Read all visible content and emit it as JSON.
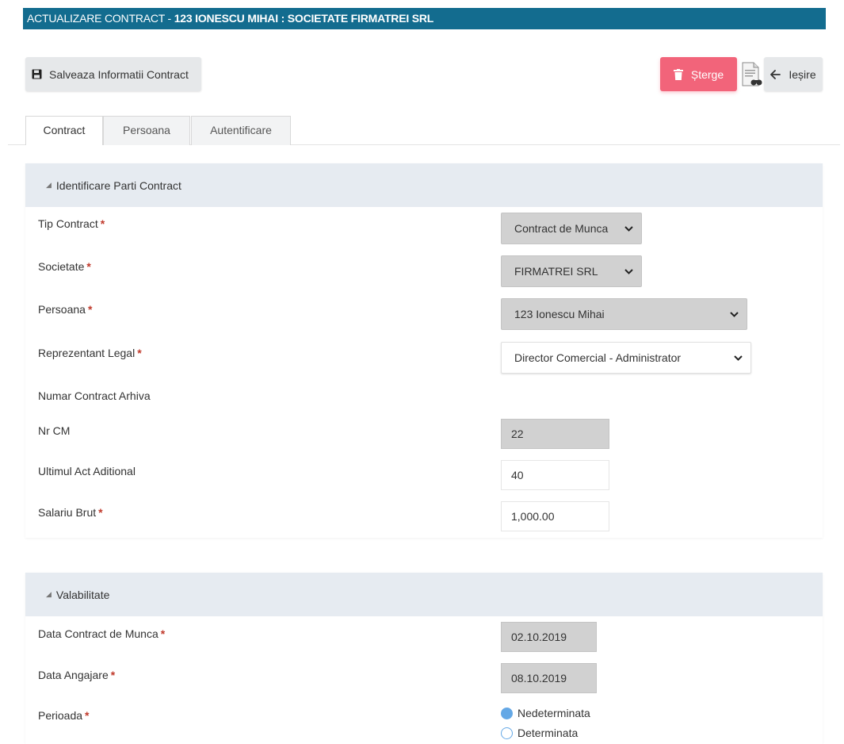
{
  "header": {
    "title_prefix": "ACTUALIZARE CONTRACT - ",
    "title_bold": "123 IONESCU MIHAI : SOCIETATE FIRMATREI SRL"
  },
  "toolbar": {
    "save_label": "Salveaza Informatii Contract",
    "delete_label": "Șterge",
    "exit_label": "Ieșire"
  },
  "tabs": [
    {
      "label": "Contract",
      "active": true
    },
    {
      "label": "Persoana",
      "active": false
    },
    {
      "label": "Autentificare",
      "active": false
    }
  ],
  "section1": {
    "title": "Identificare Parti Contract",
    "fields": {
      "tip_contract": {
        "label": "Tip Contract",
        "required": "*",
        "value": "Contract de Munca"
      },
      "societate": {
        "label": "Societate",
        "required": "*",
        "value": "FIRMATREI SRL"
      },
      "persoana": {
        "label": "Persoana",
        "required": "*",
        "value": "123 Ionescu Mihai"
      },
      "reprezentant": {
        "label": "Reprezentant Legal",
        "required": "*",
        "value": "Director Comercial - Administrator"
      },
      "numar_arhiva": {
        "label": "Numar Contract Arhiva"
      },
      "nr_cm": {
        "label": "Nr CM",
        "value": "22"
      },
      "ultimul_act": {
        "label": "Ultimul Act Aditional",
        "value": "40"
      },
      "salariu": {
        "label": "Salariu Brut",
        "required": "*",
        "value": "1,000.00"
      }
    }
  },
  "section2": {
    "title": "Valabilitate",
    "fields": {
      "data_contract": {
        "label": "Data Contract de Munca",
        "required": "*",
        "value": "02.10.2019"
      },
      "data_angajare": {
        "label": "Data Angajare",
        "required": "*",
        "value": "08.10.2019"
      },
      "perioada": {
        "label": "Perioada",
        "required": "*",
        "options": [
          {
            "label": "Nedeterminata",
            "selected": true
          },
          {
            "label": "Determinata",
            "selected": false
          }
        ]
      }
    }
  },
  "colors": {
    "title_bar": "#136c8f",
    "delete_button": "#f2647a",
    "panel_header": "#e6ebf1",
    "radio_accent": "#64a8e6"
  }
}
